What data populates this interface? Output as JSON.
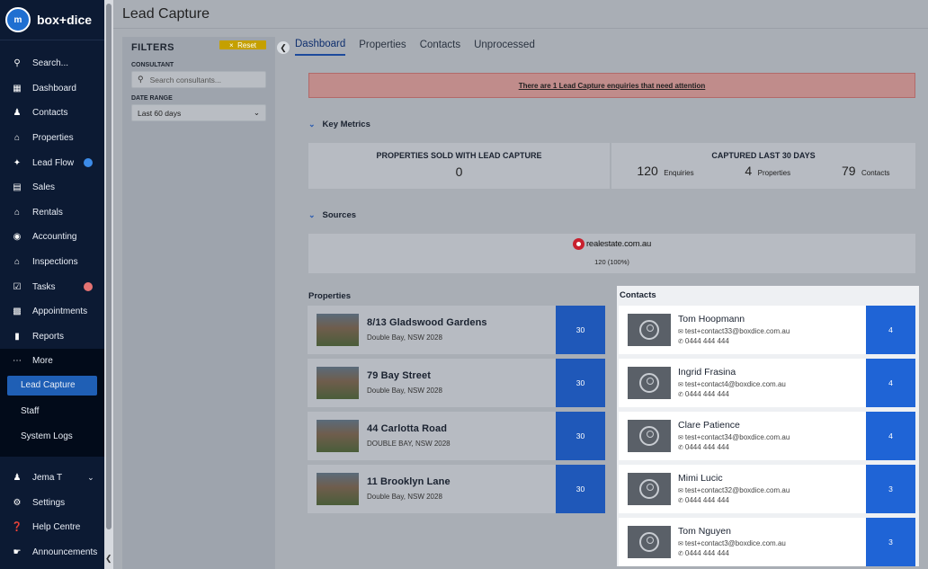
{
  "brand": {
    "logo_mark": "m",
    "logo_text": "box+dice"
  },
  "sidebar": {
    "items": [
      {
        "label": "Search...",
        "icon": "search-icon"
      },
      {
        "label": "Dashboard",
        "icon": "dashboard-icon"
      },
      {
        "label": "Contacts",
        "icon": "contacts-icon"
      },
      {
        "label": "Properties",
        "icon": "home-icon"
      },
      {
        "label": "Lead Flow",
        "icon": "lead-flow-icon",
        "badge": ""
      },
      {
        "label": "Sales",
        "icon": "sales-icon"
      },
      {
        "label": "Rentals",
        "icon": "rentals-icon"
      },
      {
        "label": "Accounting",
        "icon": "accounting-icon"
      },
      {
        "label": "Inspections",
        "icon": "inspections-icon"
      },
      {
        "label": "Tasks",
        "icon": "tasks-icon",
        "badge": ""
      },
      {
        "label": "Appointments",
        "icon": "appointments-icon"
      },
      {
        "label": "Reports",
        "icon": "reports-icon"
      },
      {
        "label": "More",
        "icon": "more-icon"
      }
    ],
    "more_items": [
      {
        "label": "Lead Capture"
      },
      {
        "label": "Staff"
      },
      {
        "label": "System Logs"
      }
    ],
    "bottom": [
      {
        "label": "Jema T",
        "icon": "user-icon"
      },
      {
        "label": "Settings",
        "icon": "gear-icon"
      },
      {
        "label": "Help Centre",
        "icon": "help-icon"
      },
      {
        "label": "Announcements",
        "icon": "megaphone-icon"
      }
    ]
  },
  "page": {
    "title": "Lead Capture"
  },
  "filters": {
    "title": "FILTERS",
    "reset_label": "Reset",
    "consultant_label": "CONSULTANT",
    "consultant_placeholder": "Search consultants...",
    "date_range_label": "DATE RANGE",
    "date_range_value": "Last 60 days"
  },
  "tabs": [
    "Dashboard",
    "Properties",
    "Contacts",
    "Unprocessed"
  ],
  "alert": {
    "text": "There are 1 Lead Capture enquiries that need attention"
  },
  "key_metrics": {
    "heading": "Key Metrics",
    "sold_title": "PROPERTIES SOLD WITH LEAD CAPTURE",
    "sold_value": "0",
    "captured_title": "CAPTURED LAST 30 DAYS",
    "enquiries_num": "120",
    "enquiries_label": "Enquiries",
    "properties_num": "4",
    "properties_label": "Properties",
    "contacts_num": "79",
    "contacts_label": "Contacts"
  },
  "sources": {
    "heading": "Sources",
    "source_name": "realestate.com.au",
    "source_count": "120 (100%)"
  },
  "properties": {
    "heading": "Properties",
    "items": [
      {
        "title": "8/13 Gladswood Gardens",
        "location": "Double Bay, NSW 2028",
        "count": "30"
      },
      {
        "title": "79 Bay Street",
        "location": "Double Bay, NSW 2028",
        "count": "30"
      },
      {
        "title": "44 Carlotta Road",
        "location": "DOUBLE BAY, NSW 2028",
        "count": "30"
      },
      {
        "title": "11 Brooklyn Lane",
        "location": "Double Bay, NSW 2028",
        "count": "30"
      }
    ]
  },
  "contacts": {
    "heading": "Contacts",
    "items": [
      {
        "name": "Tom Hoopmann",
        "email": "test+contact33@boxdice.com.au",
        "phone": "0444 444 444",
        "count": "4"
      },
      {
        "name": "Ingrid Frasina",
        "email": "test+contact4@boxdice.com.au",
        "phone": "0444 444 444",
        "count": "4"
      },
      {
        "name": "Clare Patience",
        "email": "test+contact34@boxdice.com.au",
        "phone": "0444 444 444",
        "count": "4"
      },
      {
        "name": "Mimi Lucic",
        "email": "test+contact32@boxdice.com.au",
        "phone": "0444 444 444",
        "count": "3"
      },
      {
        "name": "Tom Nguyen",
        "email": "test+contact3@boxdice.com.au",
        "phone": "0444 444 444",
        "count": "3"
      }
    ]
  }
}
